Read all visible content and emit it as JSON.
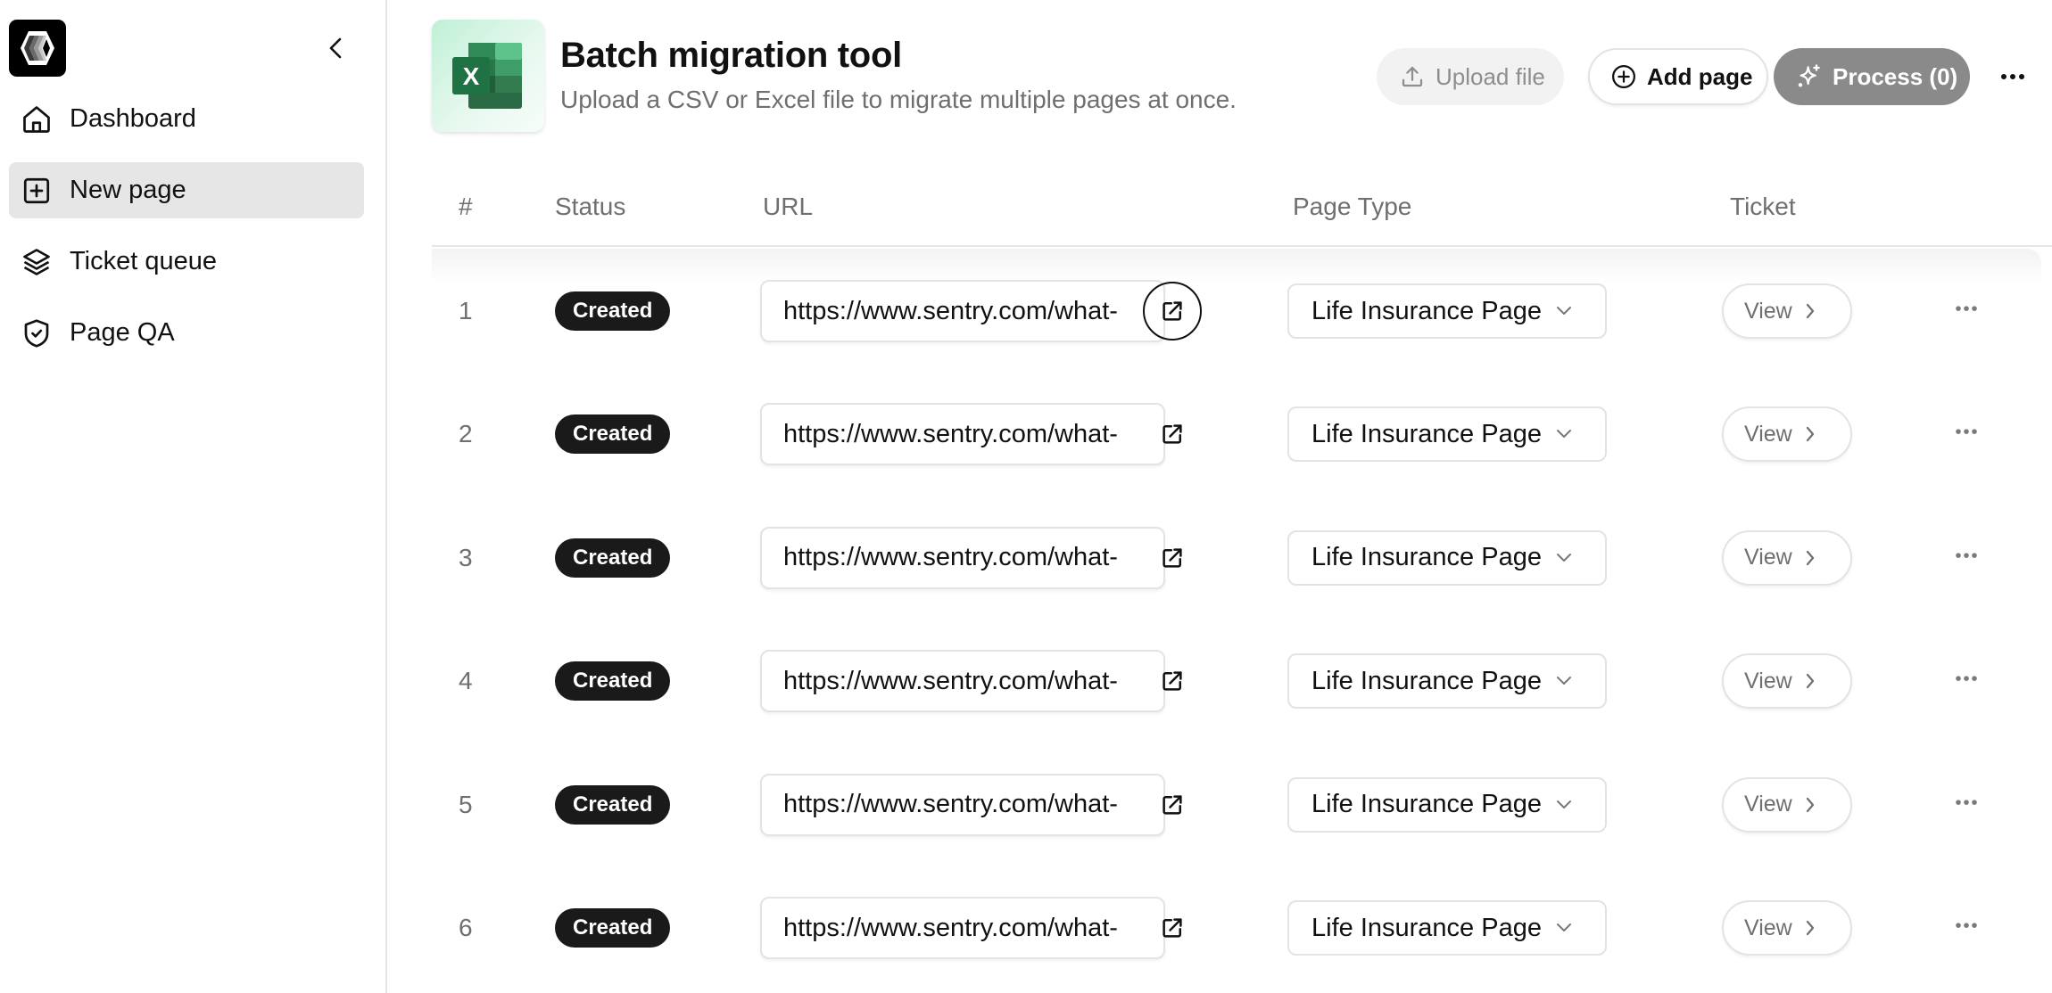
{
  "sidebar": {
    "logo_icon": "hexagon-gradient-logo",
    "collapse_icon": "chevron-left-icon",
    "items": [
      {
        "label": "Dashboard",
        "icon": "home-icon",
        "active": false
      },
      {
        "label": "New page",
        "icon": "plus-square-icon",
        "active": true
      },
      {
        "label": "Ticket queue",
        "icon": "layers-icon",
        "active": false
      },
      {
        "label": "Page QA",
        "icon": "shield-check-icon",
        "active": false
      }
    ]
  },
  "header": {
    "icon": "excel-icon",
    "title": "Batch migration tool",
    "subtitle": "Upload a CSV or Excel file to migrate multiple pages at once.",
    "buttons": {
      "upload": {
        "label": "Upload file",
        "icon": "upload-icon",
        "disabled": true
      },
      "add": {
        "label": "Add page",
        "icon": "plus-circle-icon"
      },
      "process": {
        "label": "Process (0)",
        "icon": "sparkles-icon",
        "disabled": true
      }
    },
    "more_icon": "more-horizontal-icon"
  },
  "table": {
    "columns": [
      "#",
      "Status",
      "URL",
      "Page Type",
      "Ticket"
    ],
    "rows": [
      {
        "num": "1",
        "status": "Created",
        "url": "https://www.sentry.com/what-",
        "page_type": "Life Insurance Page",
        "ticket": "View"
      },
      {
        "num": "2",
        "status": "Created",
        "url": "https://www.sentry.com/what-",
        "page_type": "Life Insurance Page",
        "ticket": "View"
      },
      {
        "num": "3",
        "status": "Created",
        "url": "https://www.sentry.com/what-",
        "page_type": "Life Insurance Page",
        "ticket": "View"
      },
      {
        "num": "4",
        "status": "Created",
        "url": "https://www.sentry.com/what-",
        "page_type": "Life Insurance Page",
        "ticket": "View"
      },
      {
        "num": "5",
        "status": "Created",
        "url": "https://www.sentry.com/what-",
        "page_type": "Life Insurance Page",
        "ticket": "View"
      },
      {
        "num": "6",
        "status": "Created",
        "url": "https://www.sentry.com/what-",
        "page_type": "Life Insurance Page",
        "ticket": "View"
      }
    ]
  },
  "colors": {
    "badge_bg": "#1a1a1a",
    "process_bg": "#8a8a8a",
    "active_nav_bg": "#e6e6e6",
    "muted_text": "#6f6f6f",
    "excel_green": "#217346"
  }
}
